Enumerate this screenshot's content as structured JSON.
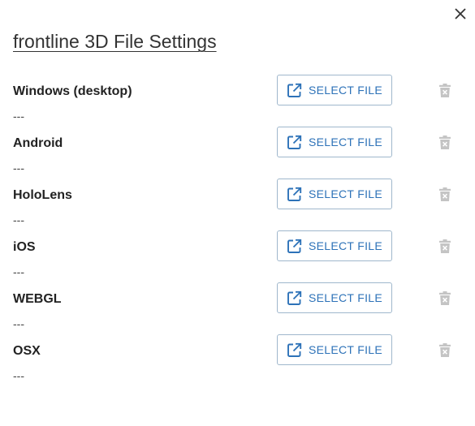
{
  "dialog": {
    "title": "frontline 3D File Settings",
    "close_icon": "close-icon"
  },
  "platforms": [
    {
      "name": "Windows (desktop)",
      "file": "---",
      "button_label": "SELECT FILE"
    },
    {
      "name": "Android",
      "file": "---",
      "button_label": "SELECT FILE"
    },
    {
      "name": "HoloLens",
      "file": "---",
      "button_label": "SELECT FILE"
    },
    {
      "name": "iOS",
      "file": "---",
      "button_label": "SELECT FILE"
    },
    {
      "name": "WEBGL",
      "file": "---",
      "button_label": "SELECT FILE"
    },
    {
      "name": "OSX",
      "file": "---",
      "button_label": "SELECT FILE"
    }
  ],
  "icons": {
    "select": "external-link-icon",
    "delete": "trash-icon"
  },
  "colors": {
    "accent": "#2d72b8",
    "button_border": "#9fb7cc",
    "delete_icon": "#c4c4c4",
    "text": "#222222"
  }
}
